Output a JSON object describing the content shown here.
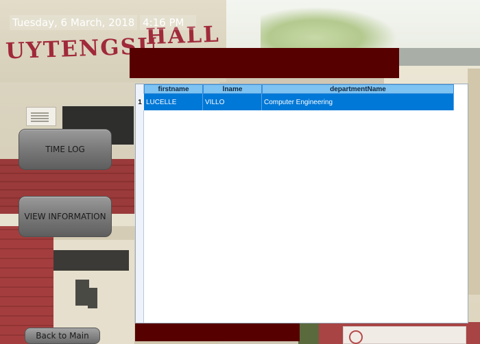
{
  "header": {
    "date": "Tuesday, 6 March, 2018",
    "time": "4:16 PM"
  },
  "background": {
    "building_sign_word1": "UYTENGSU",
    "building_sign_word2": "HALL"
  },
  "sidebar": {
    "time_log_label": "TIME LOG",
    "view_information_label": "VIEW INFORMATION",
    "back_label": "Back to Main"
  },
  "grid": {
    "columns": [
      "firstname",
      "lname",
      "departmentName"
    ],
    "rows": [
      {
        "number": "1",
        "firstname": "LUCELLE",
        "lname": "VILLO",
        "departmentName": "Computer Engineering"
      }
    ]
  },
  "colors": {
    "banner": "#570000",
    "selected_row": "#0078d7",
    "header_cell": "#7ec3f2"
  }
}
